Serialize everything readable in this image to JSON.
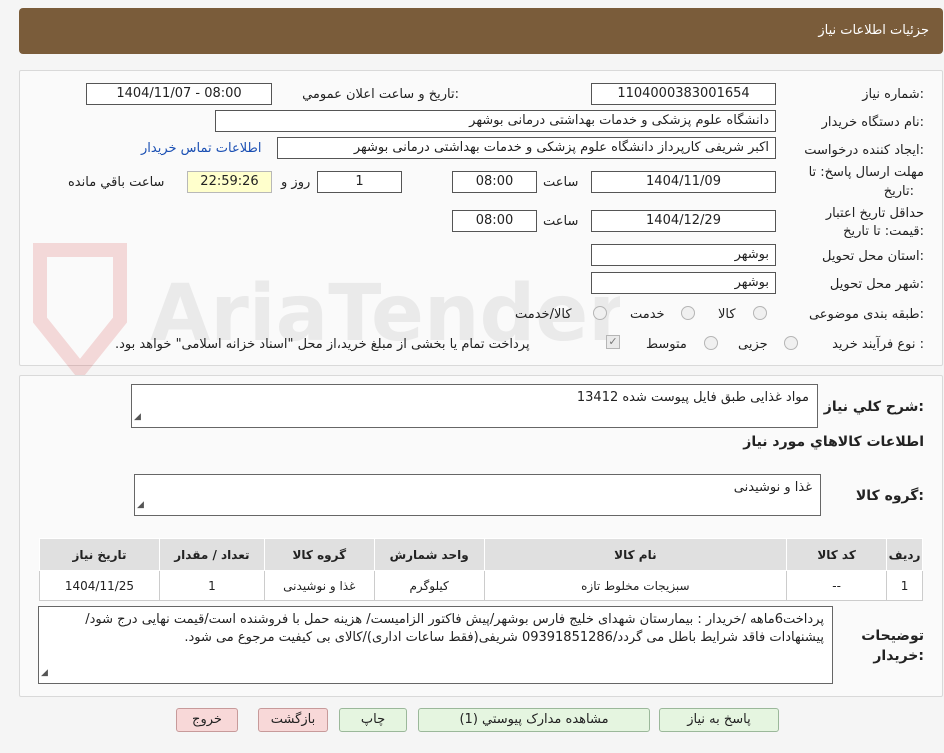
{
  "header": {
    "title": "جزئیات اطلاعات نیاز"
  },
  "form": {
    "need_number_label": "شماره نیاز:",
    "need_number": "1104000383001654",
    "announce_label": "تاریخ و ساعت اعلان عمومي:",
    "announce_value": "1404/11/07 - 08:00",
    "buyer_org_label": "نام دستگاه خریدار:",
    "buyer_org": "دانشگاه علوم پزشکی و خدمات بهداشتی درمانی بوشهر",
    "creator_label": "ایجاد کننده درخواست:",
    "creator": "اکبر شریفی کارپرداز دانشگاه علوم پزشکی و خدمات بهداشتی درمانی بوشهر",
    "contact_link": "اطلاعات تماس خریدار",
    "deadline_label_1": "مهلت ارسال پاسخ: تا",
    "deadline_label_2": "تاریخ:",
    "deadline_date": "1404/11/09",
    "time_label": "ساعت",
    "deadline_time": "08:00",
    "days_value": "1",
    "days_label": "روز و",
    "remaining_time": "22:59:26",
    "remaining_label": "ساعت باقي مانده",
    "validity_label_1": "حداقل تاریخ اعتبار",
    "validity_label_2": "قیمت: تا تاریخ:",
    "validity_date": "1404/12/29",
    "validity_time": "08:00",
    "province_label": "استان محل تحویل:",
    "province": "بوشهر",
    "city_label": "شهر محل تحویل:",
    "city": "بوشهر",
    "category_label": "طبقه بندی موضوعی:",
    "category_options": [
      "کالا",
      "خدمت",
      "کالا/خدمت"
    ],
    "process_label": "نوع فرآیند خرید :",
    "process_options": [
      "جزیی",
      "متوسط"
    ],
    "payment_note": "پرداخت تمام یا بخشی از مبلغ خرید،از محل \"اسناد خزانه اسلامی\" خواهد بود."
  },
  "description": {
    "label": "شرح کلي نیاز:",
    "value": "مواد غذایی طبق فایل پیوست شده 13412",
    "items_heading": "اطلاعات کالاهاي مورد نیاز",
    "group_label": "گروه کالا:",
    "group_value": "غذا و نوشیدنی"
  },
  "table": {
    "headers": [
      "ردیف",
      "کد کالا",
      "نام کالا",
      "واحد شمارش",
      "گروه کالا",
      "تعداد / مقدار",
      "تاریخ نیاز"
    ],
    "rows": [
      [
        "1",
        "--",
        "سبزیجات مخلوط تازه",
        "کیلوگرم",
        "غذا و نوشیدنی",
        "1",
        "1404/11/25"
      ]
    ]
  },
  "buyer_notes": {
    "label_1": "توضیحات",
    "label_2": "خریدار:",
    "value": "پرداخت6ماهه /خریدار : بیمارستان شهدای خلیج فارس بوشهر/پیش فاکتور الزامیست/ هزینه حمل با فروشنده است/قیمت نهایی درج شود/پیشنهادات فاقد شرایط باطل می گردد/09391851286 شریفی(فقط ساعات اداری)/کالای بی کیفیت مرجوع می شود."
  },
  "buttons": {
    "reply": "پاسخ به نیاز",
    "attachments": "مشاهده مدارک پیوستي (1)",
    "print": "چاپ",
    "back": "بازگشت",
    "exit": "خروج"
  },
  "watermark_text": "AriaTender.neT",
  "colors": {
    "header": "#7a5c3a",
    "green_btn": "#e5f5e0",
    "pink_btn": "#f8d8d8",
    "link": "#1a4fb3"
  }
}
